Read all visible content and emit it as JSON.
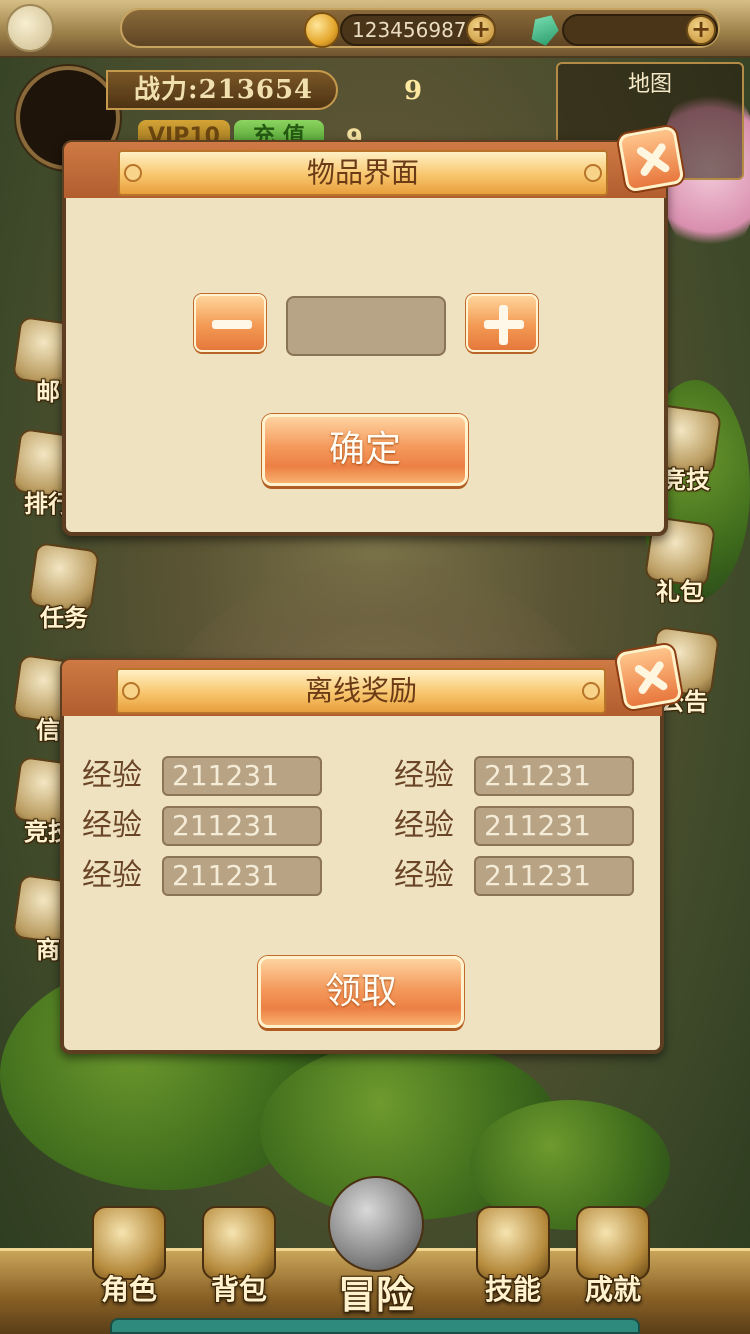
{
  "top_bar": {
    "gold_amount": "123456987",
    "gem_amount": "",
    "add_symbol": "+"
  },
  "player": {
    "power_text": "战力:213654",
    "level": "9",
    "vip_label": "VIP10",
    "recharge_label": "充 值",
    "recharge_value": "9"
  },
  "map": {
    "title": "地图"
  },
  "side_menu_left": [
    {
      "label": "邮"
    },
    {
      "label": "排行"
    },
    {
      "label": "任务"
    },
    {
      "label": "信"
    },
    {
      "label": "竞技"
    },
    {
      "label": "商"
    }
  ],
  "side_menu_right": [
    {
      "label": "竞技"
    },
    {
      "label": "礼包"
    },
    {
      "label": "公告"
    }
  ],
  "item_dialog": {
    "title": "物品界面",
    "quantity": "",
    "confirm_label": "确定"
  },
  "offline_dialog": {
    "title": "离线奖励",
    "rewards": [
      {
        "label": "经验",
        "value": "211231"
      },
      {
        "label": "经验",
        "value": "211231"
      },
      {
        "label": "经验",
        "value": "211231"
      },
      {
        "label": "经验",
        "value": "211231"
      },
      {
        "label": "经验",
        "value": "211231"
      },
      {
        "label": "经验",
        "value": "211231"
      }
    ],
    "claim_label": "领取"
  },
  "bottom_nav": [
    {
      "label": "角色",
      "icon": "helmet-icon"
    },
    {
      "label": "背包",
      "icon": "chest-icon"
    },
    {
      "label": "冒险",
      "icon": "crossed-swords-icon"
    },
    {
      "label": "技能",
      "icon": "skill-book-icon"
    },
    {
      "label": "成就",
      "icon": "scroll-icon"
    }
  ]
}
